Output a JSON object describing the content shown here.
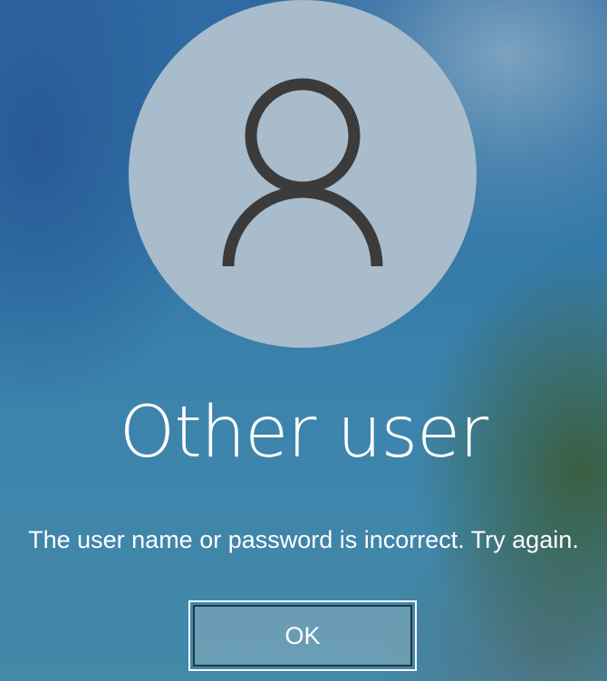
{
  "user": {
    "name": "Other user",
    "avatar_icon": "user-silhouette-icon"
  },
  "error": {
    "message": "The user name or password is incorrect. Try again."
  },
  "actions": {
    "ok_label": "OK"
  },
  "colors": {
    "avatar_background": "#a9bccb",
    "icon_stroke": "#3b3b3b",
    "text": "#ffffff"
  }
}
